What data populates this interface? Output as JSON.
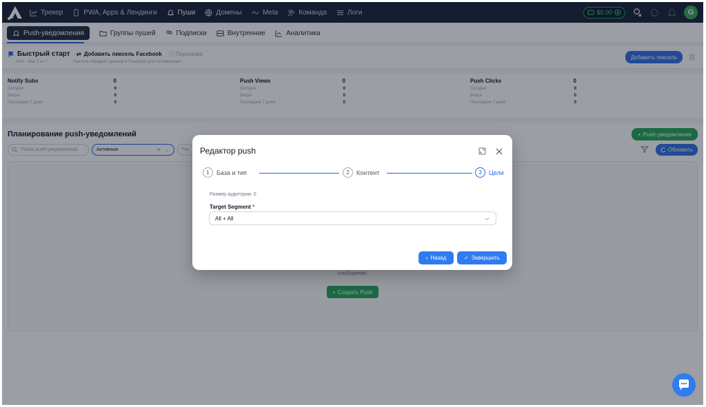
{
  "topnav": {
    "items": [
      {
        "label": "Трекер",
        "icon": "chart-line-icon"
      },
      {
        "label": "PWA, Apps & Лендинги",
        "icon": "phone-icon"
      },
      {
        "label": "Пуши",
        "icon": "bell-icon"
      },
      {
        "label": "Домены",
        "icon": "globe-icon"
      },
      {
        "label": "Meta",
        "icon": "meta-icon"
      },
      {
        "label": "Команда",
        "icon": "team-icon"
      },
      {
        "label": "Логи",
        "icon": "list-icon"
      }
    ],
    "active": "Пуши",
    "balance": "$0.00",
    "avatar_initial": "G"
  },
  "subnav": {
    "items": [
      {
        "label": "Push-уведомления",
        "icon": "bell-icon"
      },
      {
        "label": "Группы пушей",
        "icon": "folder-icon"
      },
      {
        "label": "Подписки",
        "icon": "users-icon"
      },
      {
        "label": "Внутренние",
        "icon": "inbox-icon"
      },
      {
        "label": "Аналитика",
        "icon": "chart-icon"
      }
    ],
    "active": "Push-уведомления"
  },
  "quickstart": {
    "title": "Быстрый старт",
    "step": "14% · Шаг 2 из 7",
    "action": "Добавить пиксель Facebook",
    "hint": "Подсказка",
    "description": "Пиксель передаёт данные в Facebook для оптимизации",
    "add_pixel_label": "Добавить пиксель"
  },
  "stats": [
    {
      "title": "Notify Subs",
      "total": "0",
      "rows": [
        {
          "label": "Сегодня",
          "value": "0"
        },
        {
          "label": "Вчера",
          "value": "0"
        },
        {
          "label": "Последние 7 дней",
          "value": "0"
        }
      ]
    },
    {
      "title": "Push Views",
      "total": "0",
      "rows": [
        {
          "label": "Сегодня",
          "value": "0"
        },
        {
          "label": "Вчера",
          "value": "0"
        },
        {
          "label": "Последние 7 дней",
          "value": "0"
        }
      ]
    },
    {
      "title": "Push Clicks",
      "total": "0",
      "rows": [
        {
          "label": "Сегодня",
          "value": "0"
        },
        {
          "label": "Вчера",
          "value": "0"
        },
        {
          "label": "Последние 7 дней",
          "value": "0"
        }
      ]
    }
  ],
  "planning": {
    "title": "Планирование push-уведомлений",
    "new_push_label": "Push-уведомление",
    "search_placeholder": "Поиск push-уведомлений",
    "status_filter": "Активные",
    "type_filter": "Тип",
    "refresh_label": "Обновить",
    "empty_text": "сообщения.",
    "create_push_label": "Создать Push"
  },
  "modal": {
    "title": "Редактор push",
    "steps": [
      {
        "num": "1",
        "label": "База и тип"
      },
      {
        "num": "2",
        "label": "Контент"
      },
      {
        "num": "3",
        "label": "Цели"
      }
    ],
    "active_step": "3",
    "audience_size": "Размер аудитории: 0",
    "segment_label": "Target Segment",
    "required_mark": "*",
    "segment_value": "All + All",
    "back_label": "Назад",
    "finish_label": "Завершить"
  },
  "colors": {
    "topbar": "#172238",
    "accent": "#2f7cf0",
    "success": "#24a65a"
  }
}
